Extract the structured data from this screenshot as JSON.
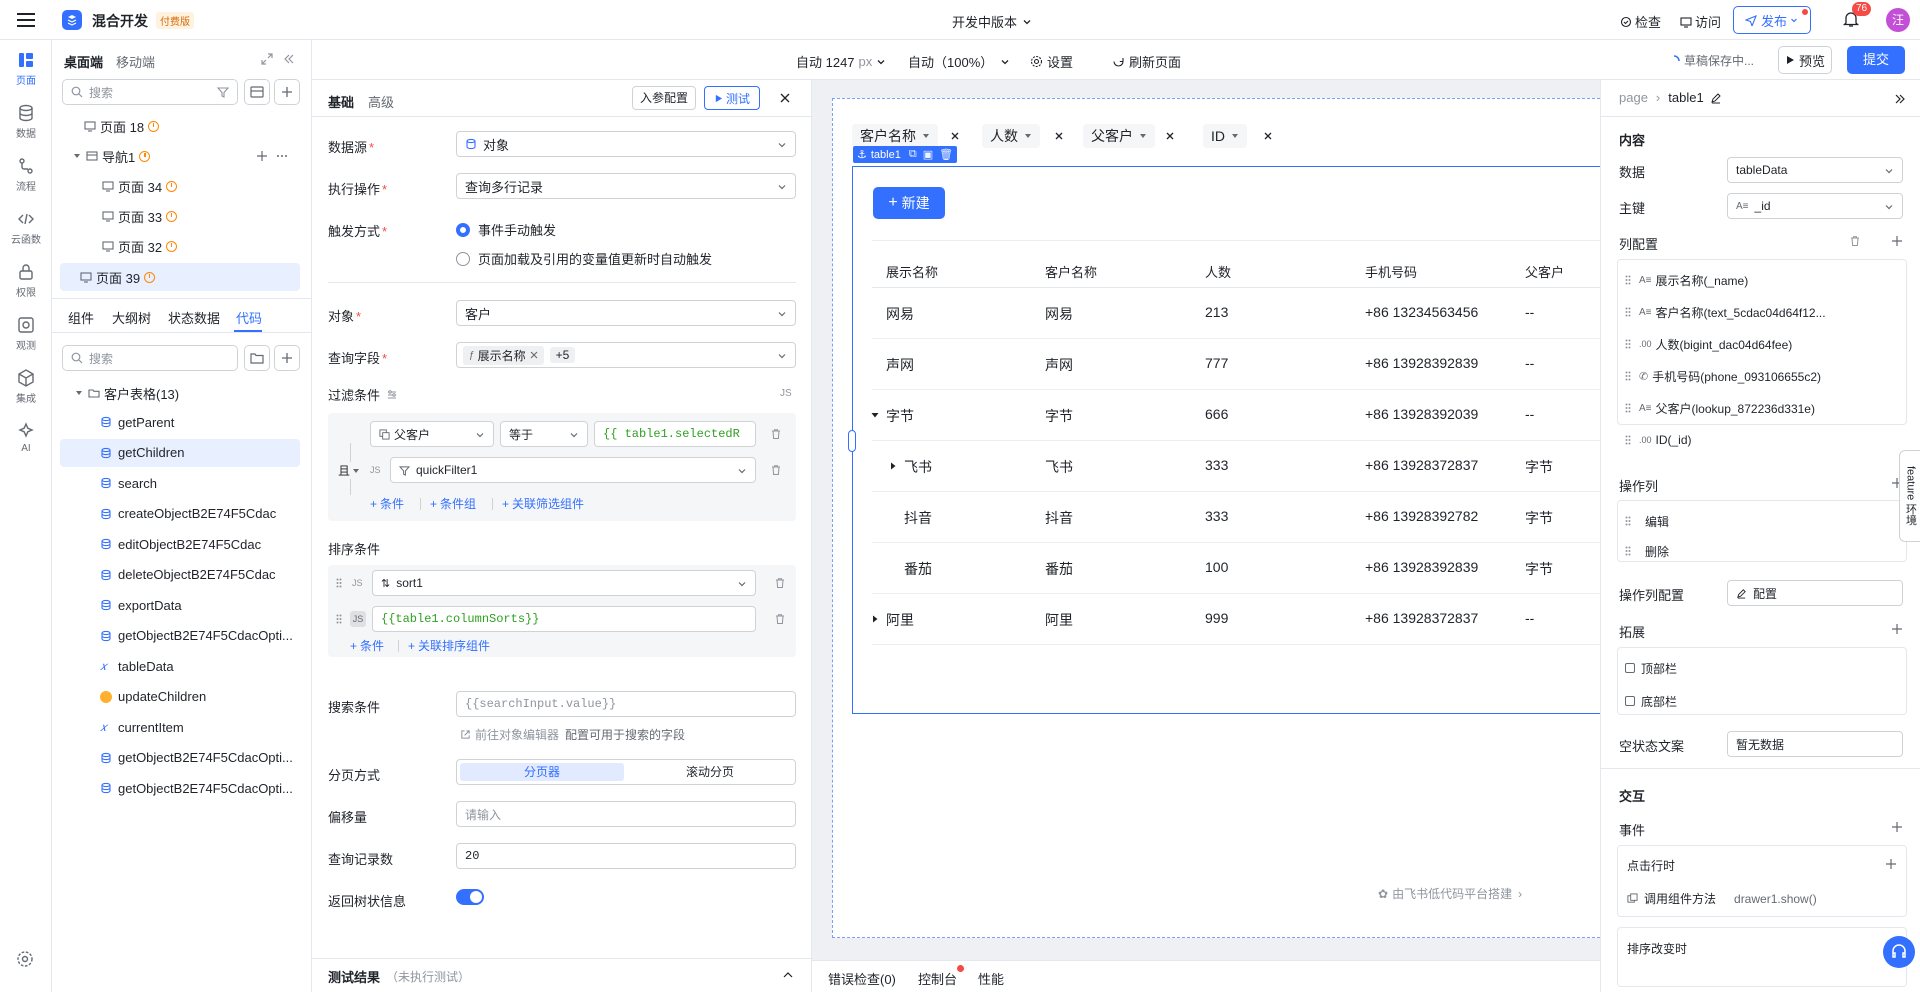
{
  "topbar": {
    "app_name": "混合开发",
    "plan_badge": "付费版",
    "version": "开发中版本",
    "check": "检查",
    "visit": "访问",
    "publish": "发布",
    "notif_count": "76",
    "avatar": "汪"
  },
  "toolbar": {
    "auto_width": "自动 1247",
    "unit": "px",
    "zoom": "自动（100%）",
    "settings": "设置",
    "refresh": "刷新页面",
    "draft": "草稿保存中...",
    "preview": "预览",
    "submit": "提交"
  },
  "rail": [
    {
      "label": "页面",
      "icon": "page-icon"
    },
    {
      "label": "数据",
      "icon": "database-icon"
    },
    {
      "label": "流程",
      "icon": "flow-icon"
    },
    {
      "label": "云函数",
      "icon": "code-icon"
    },
    {
      "label": "权限",
      "icon": "lock-icon"
    },
    {
      "label": "观测",
      "icon": "monitor-icon"
    },
    {
      "label": "集成",
      "icon": "integration-icon"
    },
    {
      "label": "AI",
      "icon": "ai-icon"
    }
  ],
  "left": {
    "tab_desktop": "桌面端",
    "tab_mobile": "移动端",
    "search_placeholder": "搜索",
    "tree": [
      {
        "label": "页面 18",
        "warn": true
      },
      {
        "label": "导航1",
        "warn": true
      },
      {
        "label": "页面 34",
        "warn": true
      },
      {
        "label": "页面 33",
        "warn": true
      },
      {
        "label": "页面 32",
        "warn": true
      },
      {
        "label": "页面 39",
        "warn": true
      }
    ],
    "tabs": [
      "组件",
      "大纲树",
      "状态数据",
      "代码"
    ],
    "search2_placeholder": "搜索",
    "group": "客户表格(13)",
    "code_items": [
      "getParent",
      "getChildren",
      "search",
      "createObjectB2E74F5Cdac",
      "editObjectB2E74F5Cdac",
      "deleteObjectB2E74F5Cdac",
      "exportData",
      "getObjectB2E74F5CdacOpti...",
      "tableData",
      "updateChildren",
      "currentItem",
      "getObjectB2E74F5CdacOpti...",
      "getObjectB2E74F5CdacOpti..."
    ]
  },
  "config": {
    "tab_basic": "基础",
    "tab_advanced": "高级",
    "params_btn": "入参配置",
    "test_btn": "测试",
    "datasource_label": "数据源",
    "datasource_value": "对象",
    "operation_label": "执行操作",
    "operation_value": "查询多行记录",
    "trigger_label": "触发方式",
    "trigger_opt1": "事件手动触发",
    "trigger_opt2": "页面加载及引用的变量值更新时自动触发",
    "object_label": "对象",
    "object_value": "客户",
    "fields_label": "查询字段",
    "fields_tag": "展示名称",
    "fields_more": "+5",
    "filter_label": "过滤条件",
    "js": "JS",
    "and": "且",
    "filter_field": "父客户",
    "filter_op": "等于",
    "filter_value": "{{ table1.selectedR",
    "quick_filter": "quickFilter1",
    "add_condition": "条件",
    "add_group": "条件组",
    "link_filter": "关联筛选组件",
    "sort_label": "排序条件",
    "sort_value": "sort1",
    "sort_expr": "{{table1.columnSorts}}",
    "add_sort": "条件",
    "link_sort": "关联排序组件",
    "search_label": "搜索条件",
    "search_value": "{{searchInput.value}}",
    "search_hint_link": "前往对象编辑器",
    "search_hint": "配置可用于搜索的字段",
    "paging_label": "分页方式",
    "paging_opt1": "分页器",
    "paging_opt2": "滚动分页",
    "offset_label": "偏移量",
    "offset_placeholder": "请输入",
    "count_label": "查询记录数",
    "count_value": "20",
    "tree_label": "返回树状信息",
    "result_label": "测试结果",
    "result_status": "（未执行测试）"
  },
  "canvas": {
    "filters": [
      "客户名称",
      "人数",
      "父客户",
      "ID"
    ],
    "component": "table1",
    "new_btn": "新建",
    "headers": [
      "展示名称",
      "客户名称",
      "人数",
      "手机号码",
      "父客户"
    ],
    "rows": [
      {
        "name": "网易",
        "cust": "网易",
        "count": "213",
        "phone": "+86 13234563456",
        "parent": "--",
        "expand": "",
        "level": 0
      },
      {
        "name": "声网",
        "cust": "声网",
        "count": "777",
        "phone": "+86 13928392839",
        "parent": "--",
        "expand": "",
        "level": 0
      },
      {
        "name": "字节",
        "cust": "字节",
        "count": "666",
        "phone": "+86 13928392039",
        "parent": "--",
        "expand": "down",
        "level": 0
      },
      {
        "name": "飞书",
        "cust": "飞书",
        "count": "333",
        "phone": "+86 13928372837",
        "parent": "字节",
        "expand": "right",
        "level": 1
      },
      {
        "name": "抖音",
        "cust": "抖音",
        "count": "333",
        "phone": "+86 13928392782",
        "parent": "字节",
        "expand": "",
        "level": 1
      },
      {
        "name": "番茄",
        "cust": "番茄",
        "count": "100",
        "phone": "+86 13928392839",
        "parent": "字节",
        "expand": "",
        "level": 1
      },
      {
        "name": "阿里",
        "cust": "阿里",
        "count": "999",
        "phone": "+86 13928372837",
        "parent": "--",
        "expand": "right",
        "level": 0
      }
    ],
    "footer": "由飞书低代码平台搭建"
  },
  "bottom": {
    "errors": "错误检查(0)",
    "console": "控制台",
    "perf": "性能"
  },
  "right": {
    "crumb_page": "page",
    "crumb_comp": "table1",
    "content": "内容",
    "data_label": "数据",
    "data_value": "tableData",
    "key_label": "主键",
    "key_value": "_id",
    "columns_label": "列配置",
    "columns": [
      {
        "icon": "text-icon",
        "label": "展示名称(_name)"
      },
      {
        "icon": "text-icon",
        "label": "客户名称(text_5cdac04d64f12..."
      },
      {
        "icon": "number-icon",
        "label": "人数(bigint_dac04d64fee)"
      },
      {
        "icon": "phone-icon",
        "label": "手机号码(phone_093106655c2)"
      },
      {
        "icon": "text-icon",
        "label": "父客户(lookup_872236d331e)"
      },
      {
        "icon": "number-icon",
        "label": "ID(_id)"
      }
    ],
    "ops_label": "操作列",
    "ops": [
      "编辑",
      "删除"
    ],
    "ops_config_label": "操作列配置",
    "ops_config_btn": "配置",
    "ext_label": "拓展",
    "ext": [
      "顶部栏",
      "底部栏"
    ],
    "empty_label": "空状态文案",
    "empty_value": "暂无数据",
    "interact": "交互",
    "events": "事件",
    "row_click": "点击行时",
    "call_method": "调用组件方法",
    "call_target": "drawer1.show()",
    "sort_change": "排序改变时",
    "feature_env": "feature 环境"
  }
}
